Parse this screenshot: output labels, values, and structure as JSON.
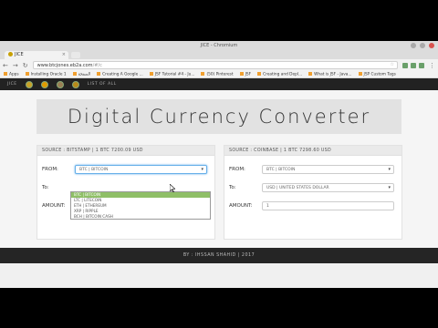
{
  "window": {
    "title": "JICE - Chromium"
  },
  "tab": {
    "label": "JICE",
    "close": "×"
  },
  "url": {
    "host": "www.btcjones.eb2a.com",
    "path": "/#/c"
  },
  "bookmarks": [
    "Apps",
    "Installing Oracle 1",
    "الصفحة",
    "Creating A Google ...",
    "JSF Tutorial #4 - Ju...",
    "(50) Pinterest",
    "JSF",
    "Creating and Depl...",
    "What is JSF - Java...",
    "JSP Custom Tags"
  ],
  "nav": {
    "brand": "JICE",
    "link": "LIST OF ALL"
  },
  "hero": {
    "title": "Digital Currency Converter"
  },
  "left_panel": {
    "header": "SOURCE : BITSTAMP | 1 BTC 7200.09 USD",
    "from_label": "FROM:",
    "from_value": "BTC | BITCOIN",
    "to_label": "To:",
    "amount_label": "AMOUNT:"
  },
  "dropdown": {
    "options": [
      "BTC | BITCOIN",
      "LTC | LITECOIN",
      "ETH | ETHEREUM",
      "XRP | RIPPLE",
      "BCH | BITCOIN CASH"
    ],
    "selected_index": 0
  },
  "right_panel": {
    "header": "SOURCE : COINBASE | 1 BTC 7298.60 USD",
    "from_label": "FROM:",
    "from_value": "BTC | BITCOIN",
    "to_label": "To:",
    "to_value": "USD | UNITED STATES DOLLAR",
    "amount_label": "AMOUNT:",
    "amount_value": "1"
  },
  "footer": {
    "text": "BY : IHSSAN SHAHID | 2017"
  }
}
